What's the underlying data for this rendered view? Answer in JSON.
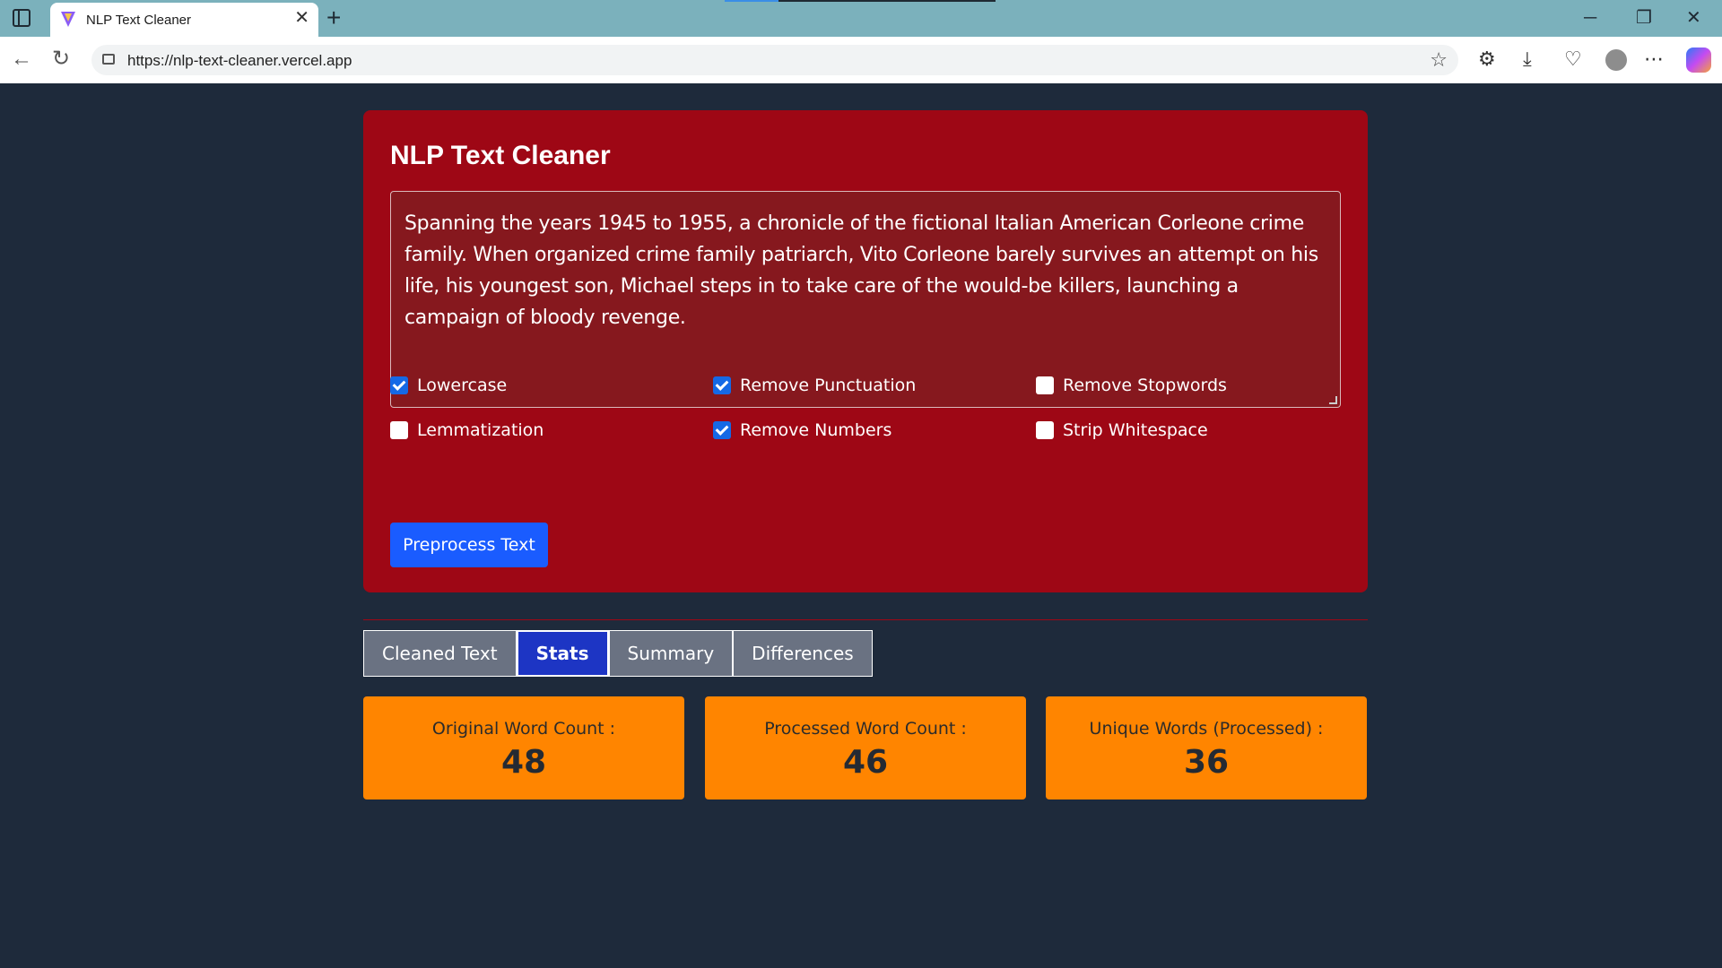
{
  "browser": {
    "tab_title": "NLP Text Cleaner",
    "url": "https://nlp-text-cleaner.vercel.app"
  },
  "app": {
    "title": "NLP Text Cleaner",
    "input_text": "Spanning the years 1945 to 1955, a chronicle of the fictional Italian American Corleone crime family. When organized crime family patriarch, Vito Corleone barely survives an attempt on his life, his youngest son, Michael steps in to take care of the would-be killers, launching a campaign of bloody revenge.",
    "options": [
      {
        "label": "Lowercase",
        "checked": true
      },
      {
        "label": "Remove Punctuation",
        "checked": true
      },
      {
        "label": "Remove Stopwords",
        "checked": false
      },
      {
        "label": "Lemmatization",
        "checked": false
      },
      {
        "label": "Remove Numbers",
        "checked": true
      },
      {
        "label": "Strip Whitespace",
        "checked": false
      }
    ],
    "submit_label": "Preprocess Text",
    "tabs": [
      {
        "label": "Cleaned Text",
        "active": false
      },
      {
        "label": "Stats",
        "active": true
      },
      {
        "label": "Summary",
        "active": false
      },
      {
        "label": "Differences",
        "active": false
      }
    ],
    "stats": [
      {
        "label": "Original Word Count :",
        "value": "48"
      },
      {
        "label": "Processed Word Count :",
        "value": "46"
      },
      {
        "label": "Unique Words (Processed) :",
        "value": "36"
      }
    ]
  },
  "colors": {
    "page_bg": "#1e2a3b",
    "card_bg": "#9e0715",
    "primary": "#1a5cff",
    "active_tab": "#1d35c4",
    "stat_bg": "#ff8500"
  }
}
